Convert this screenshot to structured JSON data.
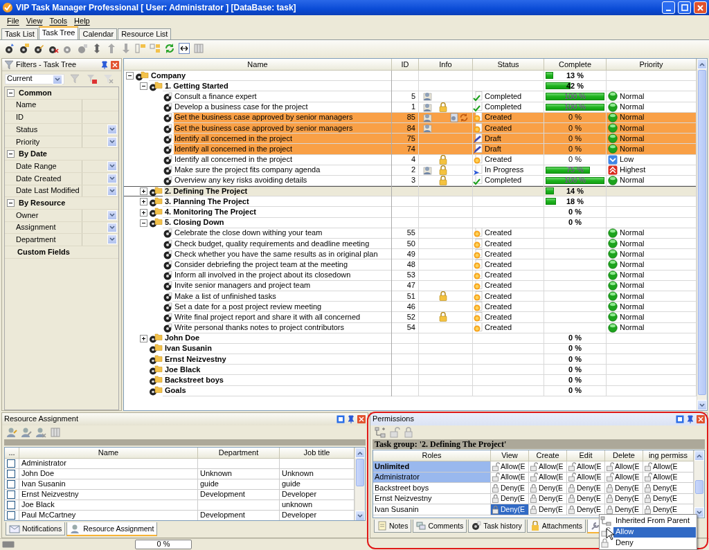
{
  "window": {
    "title": "VIP Task Manager Professional [ User: Administrator ] [DataBase: task]"
  },
  "menu": [
    "File",
    "View",
    "Tools",
    "Help"
  ],
  "tabs": [
    {
      "label": "Task List",
      "selected": false
    },
    {
      "label": "Task Tree",
      "selected": true
    },
    {
      "label": "Calendar",
      "selected": false
    },
    {
      "label": "Resource List",
      "selected": false
    }
  ],
  "filters": {
    "title": "Filters - Task Tree",
    "preset": "Current",
    "sections": [
      {
        "title": "Common",
        "expanded": true,
        "items": [
          {
            "label": "Name",
            "dropdown": false
          },
          {
            "label": "ID",
            "dropdown": false
          },
          {
            "label": "Status",
            "dropdown": true
          },
          {
            "label": "Priority",
            "dropdown": true
          }
        ]
      },
      {
        "title": "By Date",
        "expanded": true,
        "items": [
          {
            "label": "Date Range",
            "dropdown": true
          },
          {
            "label": "Date Created",
            "dropdown": true
          },
          {
            "label": "Date Last Modified",
            "dropdown": true
          }
        ]
      },
      {
        "title": "By Resource",
        "expanded": true,
        "items": [
          {
            "label": "Owner",
            "dropdown": true
          },
          {
            "label": "Assignment",
            "dropdown": true
          },
          {
            "label": "Department",
            "dropdown": true
          }
        ]
      },
      {
        "title": "Custom Fields"
      }
    ]
  },
  "tree": {
    "columns": [
      "Name",
      "ID",
      "Info",
      "Status",
      "Complete",
      "Priority"
    ],
    "rows": [
      {
        "name": "Company",
        "kind": "group",
        "expanded": true,
        "selected": false,
        "complete": "13 %",
        "level": 0.13,
        "children": [
          {
            "name": "1. Getting Started",
            "kind": "group",
            "expanded": true,
            "selected": false,
            "complete": "42 %",
            "level": 0.42,
            "children": [
              {
                "name": "Consult a finance expert",
                "kind": "task",
                "selected": false,
                "highlighted": false,
                "id": "5",
                "assigned": true,
                "locked": false,
                "linked": false,
                "recurring": false,
                "status": {
                  "kind": "completed",
                  "text": "Completed"
                },
                "complete": "100 %",
                "level": 1,
                "priority": {
                  "kind": "normal",
                  "text": "Normal"
                }
              },
              {
                "name": "Develop a business case for the project",
                "kind": "task",
                "selected": false,
                "highlighted": false,
                "id": "1",
                "assigned": true,
                "locked": true,
                "linked": false,
                "recurring": false,
                "status": {
                  "kind": "completed",
                  "text": "Completed"
                },
                "complete": "100 %",
                "level": 1,
                "priority": {
                  "kind": "normal",
                  "text": "Normal"
                }
              },
              {
                "name": "Get the business case approved by senior managers",
                "kind": "task",
                "selected": false,
                "highlighted": true,
                "id": "85",
                "assigned": true,
                "locked": false,
                "linked": true,
                "recurring": true,
                "status": {
                  "kind": "created",
                  "text": "Created"
                },
                "complete": "0 %",
                "priority": {
                  "kind": "normal",
                  "text": "Normal"
                }
              },
              {
                "name": "Get the business case approved by senior managers",
                "kind": "task",
                "selected": false,
                "highlighted": true,
                "id": "84",
                "assigned": true,
                "locked": false,
                "linked": false,
                "recurring": false,
                "status": {
                  "kind": "created",
                  "text": "Created"
                },
                "complete": "0 %",
                "priority": {
                  "kind": "normal",
                  "text": "Normal"
                }
              },
              {
                "name": "Identify all concerned in the project",
                "kind": "task",
                "selected": false,
                "highlighted": true,
                "id": "75",
                "assigned": false,
                "locked": false,
                "linked": false,
                "recurring": false,
                "status": {
                  "kind": "draft",
                  "text": "Draft"
                },
                "complete": "0 %",
                "priority": {
                  "kind": "normal",
                  "text": "Normal"
                }
              },
              {
                "name": "Identify all concerned in the project",
                "kind": "task",
                "selected": false,
                "highlighted": true,
                "id": "74",
                "assigned": false,
                "locked": false,
                "linked": false,
                "recurring": false,
                "status": {
                  "kind": "draft",
                  "text": "Draft"
                },
                "complete": "0 %",
                "priority": {
                  "kind": "normal",
                  "text": "Normal"
                }
              },
              {
                "name": "Identify all concerned in the project",
                "kind": "task",
                "selected": false,
                "highlighted": false,
                "id": "4",
                "assigned": false,
                "locked": true,
                "linked": false,
                "recurring": false,
                "status": {
                  "kind": "created",
                  "text": "Created"
                },
                "complete": "0 %",
                "priority": {
                  "kind": "low",
                  "text": "Low"
                }
              },
              {
                "name": "Make sure the project fits company agenda",
                "kind": "task",
                "selected": false,
                "highlighted": false,
                "id": "2",
                "assigned": true,
                "locked": true,
                "linked": false,
                "recurring": false,
                "status": {
                  "kind": "inprogress",
                  "text": "In Progress"
                },
                "complete": "75 %",
                "level": 0.75,
                "priority": {
                  "kind": "highest",
                  "text": "Highest"
                }
              },
              {
                "name": "Overview any key risks avoiding details",
                "kind": "task",
                "selected": false,
                "highlighted": false,
                "id": "3",
                "assigned": false,
                "locked": true,
                "linked": false,
                "recurring": false,
                "status": {
                  "kind": "completed",
                  "text": "Completed"
                },
                "complete": "100 %",
                "level": 1,
                "priority": {
                  "kind": "normal",
                  "text": "Normal"
                }
              }
            ]
          },
          {
            "name": "2. Defining The Project",
            "kind": "group",
            "expanded": false,
            "selected": true,
            "complete": "14 %",
            "level": 0.14
          },
          {
            "name": "3. Planning The Project",
            "kind": "group",
            "expanded": false,
            "selected": false,
            "complete": "18 %",
            "level": 0.18
          },
          {
            "name": "4. Monitoring The Project",
            "kind": "group",
            "expanded": false,
            "selected": false,
            "complete": "0 %"
          },
          {
            "name": "5. Closing Down",
            "kind": "group",
            "expanded": true,
            "selected": false,
            "complete": "0 %",
            "children": [
              {
                "name": "Celebrate the close down withing your team",
                "kind": "task",
                "selected": false,
                "highlighted": false,
                "id": "55",
                "assigned": false,
                "locked": false,
                "linked": false,
                "recurring": false,
                "status": {
                  "kind": "created",
                  "text": "Created"
                },
                "priority": {
                  "kind": "normal",
                  "text": "Normal"
                }
              },
              {
                "name": "Check budget, quality requirements and deadline meeting",
                "kind": "task",
                "selected": false,
                "highlighted": false,
                "id": "50",
                "assigned": false,
                "locked": false,
                "linked": false,
                "recurring": false,
                "status": {
                  "kind": "created",
                  "text": "Created"
                },
                "priority": {
                  "kind": "normal",
                  "text": "Normal"
                }
              },
              {
                "name": "Check whether you have the same results as in original plan",
                "kind": "task",
                "selected": false,
                "highlighted": false,
                "id": "49",
                "assigned": false,
                "locked": false,
                "linked": false,
                "recurring": false,
                "status": {
                  "kind": "created",
                  "text": "Created"
                },
                "priority": {
                  "kind": "normal",
                  "text": "Normal"
                }
              },
              {
                "name": "Consider debriefing the project team at the meeting",
                "kind": "task",
                "selected": false,
                "highlighted": false,
                "id": "48",
                "assigned": false,
                "locked": false,
                "linked": false,
                "recurring": false,
                "status": {
                  "kind": "created",
                  "text": "Created"
                },
                "priority": {
                  "kind": "normal",
                  "text": "Normal"
                }
              },
              {
                "name": "Inform all involved in the project about its closedown",
                "kind": "task",
                "selected": false,
                "highlighted": false,
                "id": "53",
                "assigned": false,
                "locked": false,
                "linked": false,
                "recurring": false,
                "status": {
                  "kind": "created",
                  "text": "Created"
                },
                "priority": {
                  "kind": "normal",
                  "text": "Normal"
                }
              },
              {
                "name": "Invite senior managers and project team",
                "kind": "task",
                "selected": false,
                "highlighted": false,
                "id": "47",
                "assigned": false,
                "locked": false,
                "linked": false,
                "recurring": false,
                "status": {
                  "kind": "created",
                  "text": "Created"
                },
                "priority": {
                  "kind": "normal",
                  "text": "Normal"
                }
              },
              {
                "name": "Make a list of unfinished tasks",
                "kind": "task",
                "selected": false,
                "highlighted": false,
                "id": "51",
                "assigned": false,
                "locked": true,
                "linked": false,
                "recurring": false,
                "status": {
                  "kind": "created",
                  "text": "Created"
                },
                "priority": {
                  "kind": "normal",
                  "text": "Normal"
                }
              },
              {
                "name": "Set a date for a post project review meeting",
                "kind": "task",
                "selected": false,
                "highlighted": false,
                "id": "46",
                "assigned": false,
                "locked": false,
                "linked": false,
                "recurring": false,
                "status": {
                  "kind": "created",
                  "text": "Created"
                },
                "priority": {
                  "kind": "normal",
                  "text": "Normal"
                }
              },
              {
                "name": "Write final project report and share it with all concerned",
                "kind": "task",
                "selected": false,
                "highlighted": false,
                "id": "52",
                "assigned": false,
                "locked": true,
                "linked": false,
                "recurring": false,
                "status": {
                  "kind": "created",
                  "text": "Created"
                },
                "priority": {
                  "kind": "normal",
                  "text": "Normal"
                }
              },
              {
                "name": "Write personal thanks notes to project contributors",
                "kind": "task",
                "selected": false,
                "highlighted": false,
                "id": "54",
                "assigned": false,
                "locked": false,
                "linked": false,
                "recurring": false,
                "status": {
                  "kind": "created",
                  "text": "Created"
                },
                "priority": {
                  "kind": "normal",
                  "text": "Normal"
                }
              }
            ]
          },
          {
            "name": "John Doe",
            "kind": "group",
            "expanded": false,
            "selected": false,
            "complete": "0 %"
          },
          {
            "name": "Ivan Susanin",
            "kind": "group",
            "selected": false,
            "complete": "0 %"
          },
          {
            "name": "Ernst Neizvestny",
            "kind": "group",
            "selected": false,
            "complete": "0 %"
          },
          {
            "name": "Joe Black",
            "kind": "group",
            "selected": false,
            "complete": "0 %"
          },
          {
            "name": "Backstreet boys",
            "kind": "group",
            "selected": false,
            "complete": "0 %"
          },
          {
            "name": "Goals",
            "kind": "group",
            "selected": false,
            "complete": "0 %"
          }
        ]
      }
    ]
  },
  "resources": {
    "title": "Resource Assignment",
    "columns": [
      "...",
      "Name",
      "Department",
      "Job title"
    ],
    "rows": [
      {
        "checked": false,
        "name": "Administrator"
      },
      {
        "checked": false,
        "name": "John Doe",
        "department": "Unknown",
        "job": "Unknown"
      },
      {
        "checked": false,
        "name": "Ivan Susanin",
        "department": "guide",
        "job": "guide"
      },
      {
        "checked": false,
        "name": "Ernst Neizvestny",
        "department": "Development",
        "job": "Developer"
      },
      {
        "checked": false,
        "name": "Joe Black",
        "job": "unknown"
      },
      {
        "checked": false,
        "name": "Paul McCartney",
        "department": "Development",
        "job": "Developer"
      }
    ],
    "tabs": [
      {
        "label": "Notifications",
        "selected": false
      },
      {
        "label": "Resource Assignment",
        "selected": true
      }
    ]
  },
  "permissions": {
    "title": "Permissions",
    "caption": "Task group: '2. Defining The Project'",
    "columns": [
      "Roles",
      "View",
      "Create",
      "Edit",
      "Delete",
      "ing permiss"
    ],
    "rows": [
      {
        "selected": true,
        "cells": [
          {
            "kind": "role",
            "text": "Unlimited",
            "bold": true
          },
          {
            "kind": "allow",
            "text": "Allow(E",
            "selected": false
          },
          {
            "kind": "allow",
            "text": "Allow(E",
            "selected": false
          },
          {
            "kind": "allow",
            "text": "Allow(E",
            "selected": false
          },
          {
            "kind": "allow",
            "text": "Allow(E",
            "selected": false
          },
          {
            "kind": "allow",
            "text": "Allow(E",
            "selected": false
          }
        ]
      },
      {
        "selected": true,
        "cells": [
          {
            "kind": "role",
            "text": "Administrator",
            "bold": false
          },
          {
            "kind": "allow",
            "text": "Allow(E",
            "selected": false
          },
          {
            "kind": "allow",
            "text": "Allow(E",
            "selected": false
          },
          {
            "kind": "allow",
            "text": "Allow(E",
            "selected": false
          },
          {
            "kind": "allow",
            "text": "Allow(E",
            "selected": false
          },
          {
            "kind": "allow",
            "text": "Allow(E",
            "selected": false
          }
        ]
      },
      {
        "selected": false,
        "cells": [
          {
            "kind": "role",
            "text": "Backstreet boys",
            "bold": false
          },
          {
            "kind": "deny",
            "text": "Deny(E",
            "selected": false
          },
          {
            "kind": "deny",
            "text": "Deny(E",
            "selected": false
          },
          {
            "kind": "deny",
            "text": "Deny(E",
            "selected": false
          },
          {
            "kind": "deny",
            "text": "Deny(E",
            "selected": false
          },
          {
            "kind": "deny",
            "text": "Deny(E",
            "selected": false
          }
        ]
      },
      {
        "selected": false,
        "cells": [
          {
            "kind": "role",
            "text": "Ernst Neizvestny",
            "bold": false
          },
          {
            "kind": "deny",
            "text": "Deny(E",
            "selected": false
          },
          {
            "kind": "deny",
            "text": "Deny(E",
            "selected": false
          },
          {
            "kind": "deny",
            "text": "Deny(E",
            "selected": false
          },
          {
            "kind": "deny",
            "text": "Deny(E",
            "selected": false
          },
          {
            "kind": "deny",
            "text": "Deny(E",
            "selected": false
          }
        ]
      },
      {
        "selected": false,
        "cells": [
          {
            "kind": "role",
            "text": "Ivan Susanin",
            "bold": false
          },
          {
            "kind": "deny",
            "text": "Deny(E",
            "selected": true
          },
          {
            "kind": "deny",
            "text": "Deny(E",
            "selected": false
          },
          {
            "kind": "deny",
            "text": "Deny(E",
            "selected": false
          },
          {
            "kind": "deny",
            "text": "Deny(E",
            "selected": false
          },
          {
            "kind": "deny",
            "text": "Deny(E",
            "selected": false
          }
        ]
      }
    ],
    "tabs": [
      {
        "label": "Notes",
        "selected": false
      },
      {
        "label": "Comments",
        "selected": false
      },
      {
        "label": "Task history",
        "selected": false
      },
      {
        "label": "Attachments",
        "selected": false
      }
    ],
    "menu": [
      {
        "label": "Inherited From Parent",
        "selected": false
      },
      {
        "label": "Allow",
        "selected": true
      },
      {
        "label": "Deny",
        "selected": false
      }
    ]
  },
  "status_bar": {
    "progress": "0 %"
  }
}
